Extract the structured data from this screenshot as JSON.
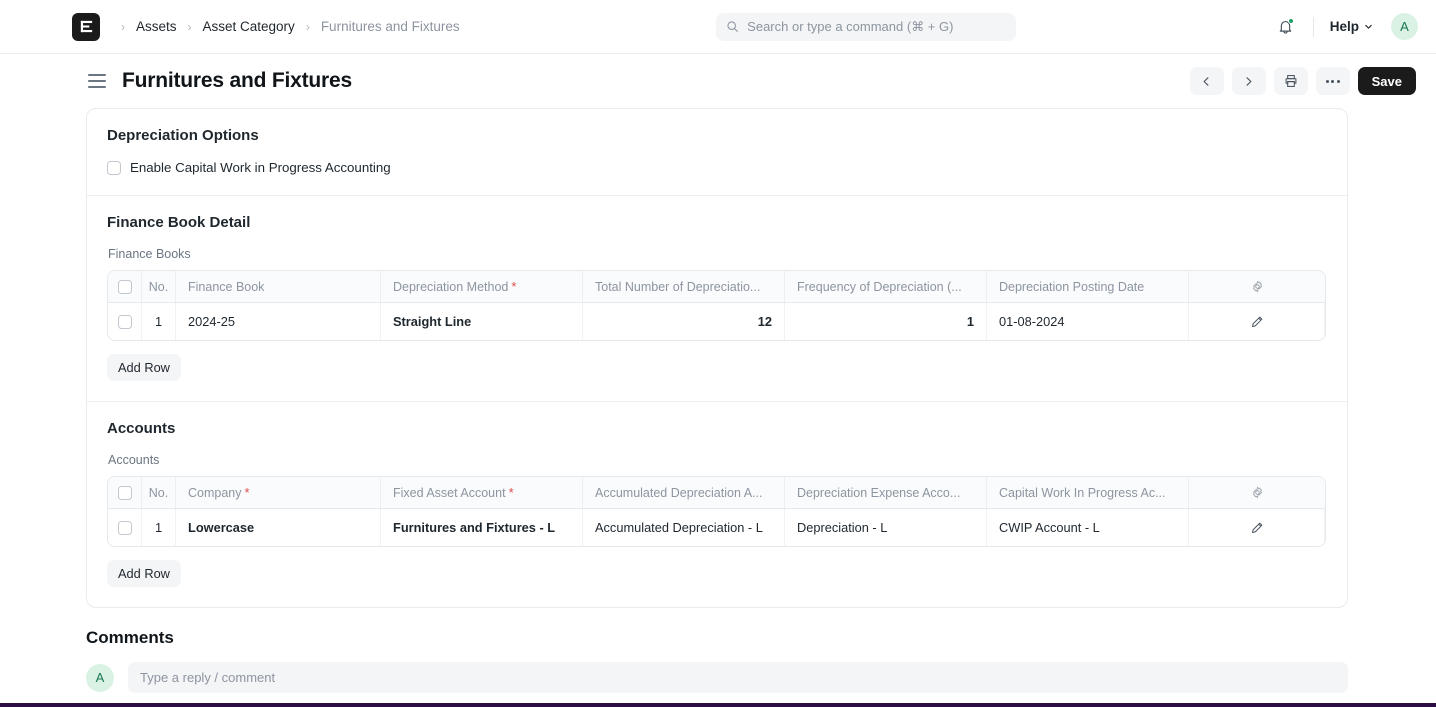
{
  "navbar": {
    "logo_icon": "frappe-logo-icon",
    "breadcrumbs": [
      {
        "label": "Assets",
        "muted": false
      },
      {
        "label": "Asset Category",
        "muted": false
      },
      {
        "label": "Furnitures and Fixtures",
        "muted": true
      }
    ],
    "separator": "›",
    "search": {
      "icon": "search-icon",
      "placeholder": "Search or type a command (⌘ + G)",
      "value": ""
    },
    "notifications_icon": "bell-icon",
    "has_notification_dot": true,
    "help_label": "Help",
    "help_chevron_icon": "chevron-down-icon",
    "avatar_initial": "A",
    "avatar_bg": "#d9f2e4",
    "avatar_fg": "#17784d"
  },
  "pagehead": {
    "menu_icon": "hamburger-menu-icon",
    "title": "Furnitures and Fixtures",
    "actions": {
      "prev_icon": "chevron-left-icon",
      "next_icon": "chevron-right-icon",
      "print_icon": "printer-icon",
      "more_icon": "ellipsis-icon",
      "save_label": "Save"
    }
  },
  "sections": {
    "depreciation_options": {
      "title": "Depreciation Options",
      "checkbox": {
        "label": "Enable Capital Work in Progress Accounting",
        "checked": false
      }
    },
    "finance_book_detail": {
      "title": "Finance Book Detail",
      "table_label": "Finance Books",
      "columns": [
        {
          "label": "No.",
          "required": false
        },
        {
          "label": "Finance Book",
          "required": false
        },
        {
          "label": "Depreciation Method",
          "required": true
        },
        {
          "label": "Total Number of Depreciatio...",
          "required": false
        },
        {
          "label": "Frequency of Depreciation (...",
          "required": false
        },
        {
          "label": "Depreciation Posting Date",
          "required": false
        }
      ],
      "settings_icon": "gear-icon",
      "rows": [
        {
          "no": "1",
          "finance_book": "2024-25",
          "depreciation_method": "Straight Line",
          "total_number_of_depreciations": "12",
          "frequency_of_depreciation": "1",
          "depreciation_posting_date": "01-08-2024",
          "edit_icon": "pencil-icon"
        }
      ],
      "add_row_label": "Add Row"
    },
    "accounts": {
      "title": "Accounts",
      "table_label": "Accounts",
      "columns": [
        {
          "label": "No.",
          "required": false
        },
        {
          "label": "Company",
          "required": true
        },
        {
          "label": "Fixed Asset Account",
          "required": true
        },
        {
          "label": "Accumulated Depreciation A...",
          "required": false
        },
        {
          "label": "Depreciation Expense Acco...",
          "required": false
        },
        {
          "label": "Capital Work In Progress Ac...",
          "required": false
        }
      ],
      "settings_icon": "gear-icon",
      "rows": [
        {
          "no": "1",
          "company": "Lowercase",
          "fixed_asset_account": "Furnitures and Fixtures - L",
          "accumulated_depreciation_account": "Accumulated Depreciation - L",
          "depreciation_expense_account": "Depreciation - L",
          "capital_work_in_progress_account": "CWIP Account - L",
          "edit_icon": "pencil-icon"
        }
      ],
      "add_row_label": "Add Row"
    }
  },
  "comments": {
    "title": "Comments",
    "avatar_initial": "A",
    "input_placeholder": "Type a reply / comment",
    "input_value": ""
  }
}
